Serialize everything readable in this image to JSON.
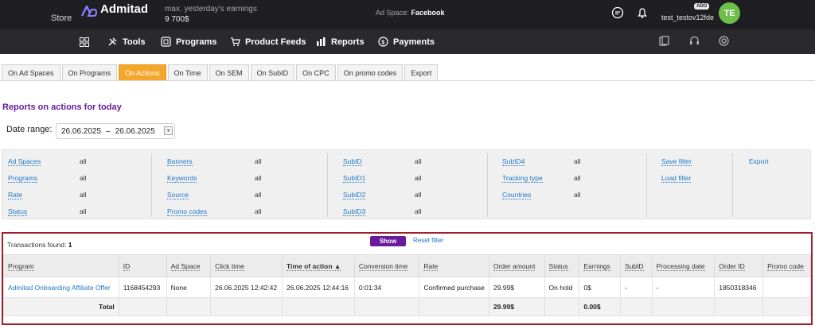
{
  "header": {
    "logo_name": "Admitad",
    "logo_sub": "Store",
    "earnings_label": "max. yesterday's earnings",
    "earnings_value": "9 700$",
    "ad_space_label": "Ad Space:",
    "ad_space_value": "Facebook",
    "username": "test_testov12fde",
    "badge": "ADO",
    "avatar_initials": "TE",
    "avatar_color": "#6cc04a"
  },
  "nav": {
    "items": [
      "Tools",
      "Programs",
      "Product Feeds",
      "Reports",
      "Payments"
    ],
    "icons": [
      "grid-icon",
      "tools-icon",
      "programs-icon",
      "cart-icon",
      "chart-icon",
      "payment-icon"
    ]
  },
  "tabs": [
    {
      "label": "On Ad Spaces",
      "active": false
    },
    {
      "label": "On Programs",
      "active": false
    },
    {
      "label": "On Actions",
      "active": true
    },
    {
      "label": "On Time",
      "active": false
    },
    {
      "label": "On SEM",
      "active": false
    },
    {
      "label": "On SubID",
      "active": false
    },
    {
      "label": "On CPC",
      "active": false
    },
    {
      "label": "On promo codes",
      "active": false
    },
    {
      "label": "Export",
      "active": false
    }
  ],
  "page_title": "Reports on actions for today",
  "date_range": {
    "label": "Date range:",
    "from": "26.06.2025",
    "sep": "–",
    "to": "26.06.2025"
  },
  "filters": {
    "col1": [
      {
        "key": "Ad Spaces",
        "value": "all"
      },
      {
        "key": "Programs",
        "value": "all"
      },
      {
        "key": "Rate",
        "value": "all"
      },
      {
        "key": "Status",
        "value": "all"
      }
    ],
    "col2": [
      {
        "key": "Banners",
        "value": "all"
      },
      {
        "key": "Keywords",
        "value": "all"
      },
      {
        "key": "Source",
        "value": "all"
      },
      {
        "key": "Promo codes",
        "value": "all"
      }
    ],
    "col3": [
      {
        "key": "SubID",
        "value": "all"
      },
      {
        "key": "SubID1",
        "value": "all"
      },
      {
        "key": "SubID2",
        "value": "all"
      },
      {
        "key": "SubID3",
        "value": "all"
      }
    ],
    "col4": [
      {
        "key": "SubID4",
        "value": "all"
      },
      {
        "key": "Tracking type",
        "value": "all"
      },
      {
        "key": "Countries",
        "value": "all"
      }
    ],
    "actions": [
      "Save filter",
      "Load filter"
    ],
    "export": "Export"
  },
  "results": {
    "found_label": "Transactions found:",
    "found_count": "1",
    "show_button": "Show",
    "reset_filter": "Reset filter",
    "columns": [
      "Program",
      "ID",
      "Ad Space",
      "Click time",
      "Time of action ▲",
      "Conversion time",
      "Rate",
      "Order amount",
      "Status",
      "Earnings",
      "SubID",
      "Processing date",
      "Order ID",
      "Promo code"
    ],
    "rows": [
      [
        "Admitad Onboarding Affiliate Offer",
        "1168454293",
        "None",
        "26.06.2025 12:42:42",
        "26.06.2025 12:44:16",
        "0:01:34",
        "Confirmed purchase",
        "29.99$",
        "On hold",
        "0$",
        "-",
        "-",
        "1850318346",
        ""
      ]
    ],
    "total": {
      "label": "Total",
      "order_amount": "29.99$",
      "earnings": "0.00$"
    }
  }
}
